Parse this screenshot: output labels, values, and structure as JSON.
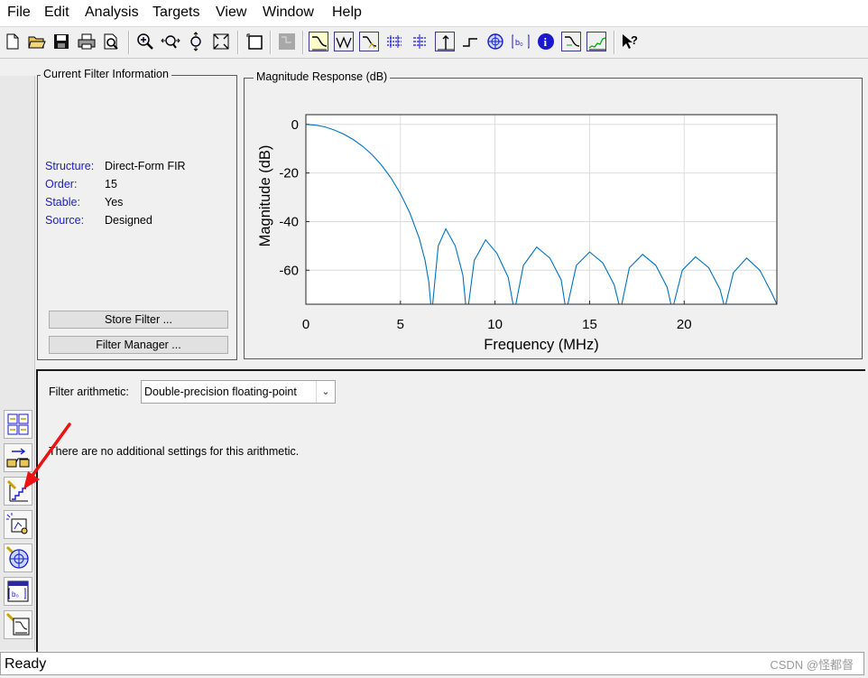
{
  "menu": [
    "File",
    "Edit",
    "Analysis",
    "Targets",
    "View",
    "Window",
    "Help"
  ],
  "icons": {
    "toolbar": [
      "new-file-icon",
      "open-folder-icon",
      "save-icon",
      "print-icon",
      "print-preview-icon",
      "zoom-in-icon",
      "zoom-x-icon",
      "zoom-y-icon",
      "full-view-icon",
      "new-window-icon",
      "grid-disabled-icon",
      "magnitude-response-icon",
      "phase-response-icon",
      "magnitude-phase-icon",
      "group-delay-icon",
      "phase-delay-icon",
      "impulse-response-icon",
      "step-response-icon",
      "pole-zero-icon",
      "filter-coefficients-icon",
      "filter-info-icon",
      "magnitude-estimate-icon",
      "noise-power-icon",
      "whats-this-help-icon"
    ],
    "sidebar": [
      "design-filter-icon",
      "transform-filter-icon",
      "set-quantization-icon",
      "realize-model-icon",
      "pole-zero-editor-icon",
      "import-filter-icon",
      "multirate-icon"
    ]
  },
  "filter_info": {
    "title": "Current Filter Information",
    "rows": [
      {
        "label": "Structure:",
        "value": "Direct-Form FIR"
      },
      {
        "label": "Order:",
        "value": "15"
      },
      {
        "label": "Stable:",
        "value": "Yes"
      },
      {
        "label": "Source:",
        "value": "Designed"
      }
    ],
    "store_button": "Store Filter ...",
    "manager_button": "Filter Manager ..."
  },
  "plot_panel": {
    "title": "Magnitude Response (dB)"
  },
  "chart_data": {
    "type": "line",
    "xlabel": "Frequency (MHz)",
    "ylabel": "Magnitude (dB)",
    "xlim": [
      0,
      24.9
    ],
    "ylim": [
      -74,
      4
    ],
    "xticks": [
      0,
      5,
      10,
      15,
      20
    ],
    "yticks": [
      0,
      -20,
      -40,
      -60
    ],
    "grid": true,
    "series": [
      {
        "color": "#0072bd",
        "x": [
          0,
          0.5,
          1,
          1.5,
          2,
          2.5,
          3,
          3.5,
          4,
          4.5,
          5,
          5.5,
          6,
          6.3,
          6.5,
          6.6,
          6.7,
          7.0,
          7.4,
          7.9,
          8.3,
          8.45,
          8.6,
          8.9,
          9.5,
          10.1,
          10.7,
          10.95,
          11.1,
          11.5,
          12.2,
          12.9,
          13.5,
          13.7,
          13.85,
          14.3,
          15.0,
          15.7,
          16.3,
          16.55,
          16.7,
          17.1,
          17.8,
          18.5,
          19.1,
          19.3,
          19.45,
          19.9,
          20.6,
          21.3,
          21.9,
          22.1,
          22.2,
          22.6,
          23.3,
          24.0,
          24.6,
          24.9
        ],
        "y": [
          0,
          -0.3,
          -1.0,
          -2.3,
          -4.0,
          -6.2,
          -9.0,
          -12.5,
          -16.8,
          -22,
          -28.5,
          -36.5,
          -47,
          -56,
          -65,
          -74,
          -74,
          -50,
          -43,
          -50,
          -62,
          -74,
          -74,
          -56,
          -47.5,
          -53,
          -63,
          -74,
          -74,
          -58,
          -50.5,
          -55,
          -64,
          -74,
          -74,
          -58,
          -52.5,
          -57,
          -66,
          -74,
          -74,
          -59,
          -53.5,
          -58,
          -67,
          -74,
          -74,
          -60,
          -54.5,
          -59,
          -68,
          -74,
          -74,
          -61,
          -55,
          -60,
          -69,
          -74
        ]
      }
    ]
  },
  "arithmetic": {
    "label": "Filter arithmetic:",
    "selected": "Double-precision floating-point",
    "message": "There are no additional settings for this arithmetic."
  },
  "status": "Ready",
  "watermark": "CSDN @怪都督",
  "colors": {
    "accent_label": "#1a1acc",
    "plot_line": "#0072bd",
    "annotation_arrow": "#ee1111"
  }
}
